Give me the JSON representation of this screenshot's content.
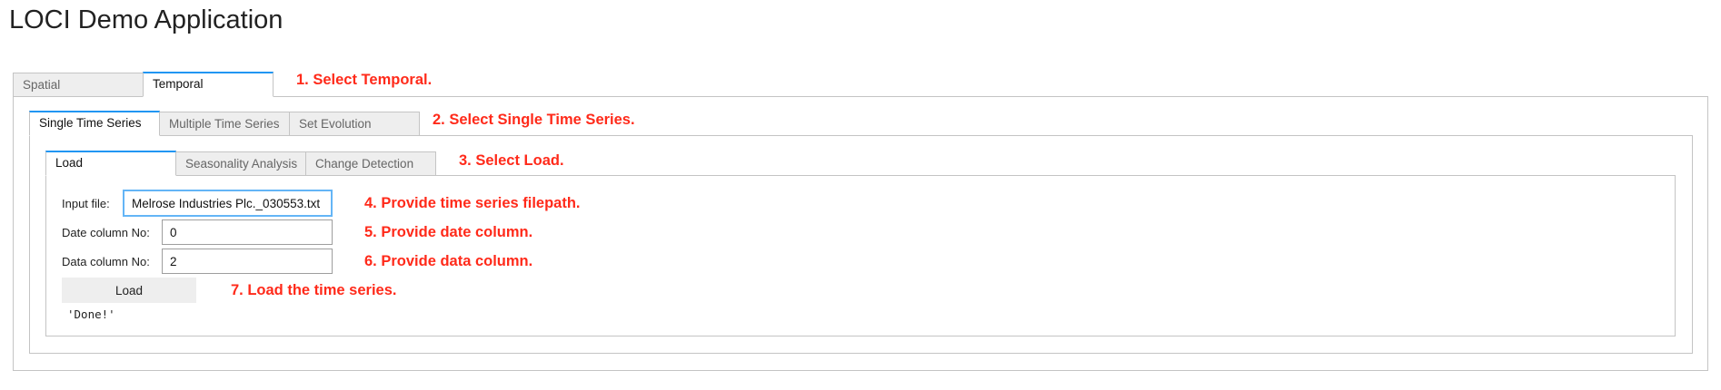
{
  "app": {
    "title": "LOCI Demo Application"
  },
  "top_tabs": [
    {
      "label": "Spatial",
      "active": false
    },
    {
      "label": "Temporal",
      "active": true
    }
  ],
  "temporal_tabs": [
    {
      "label": "Single Time Series",
      "active": true
    },
    {
      "label": "Multiple Time Series",
      "active": false
    },
    {
      "label": "Set Evolution",
      "active": false
    }
  ],
  "single_tabs": [
    {
      "label": "Load",
      "active": true
    },
    {
      "label": "Seasonality Analysis",
      "active": false
    },
    {
      "label": "Change Detection",
      "active": false
    }
  ],
  "form": {
    "input_file_label": "Input file:",
    "input_file_value": "Melrose Industries Plc._030553.txt",
    "date_col_label": "Date column No:",
    "date_col_value": "0",
    "data_col_label": "Data column No:",
    "data_col_value": "2",
    "load_button": "Load",
    "output": "'Done!'"
  },
  "annotations": [
    "1. Select Temporal.",
    "2. Select Single Time Series.",
    "3. Select Load.",
    "4. Provide time series filepath.",
    "5. Provide date column.",
    "6. Provide data column.",
    "7. Load the time series."
  ],
  "colors": {
    "annotation": "#ff2a1a",
    "active_tab_accent": "#2196f3",
    "focus_border": "#64b5f6"
  }
}
